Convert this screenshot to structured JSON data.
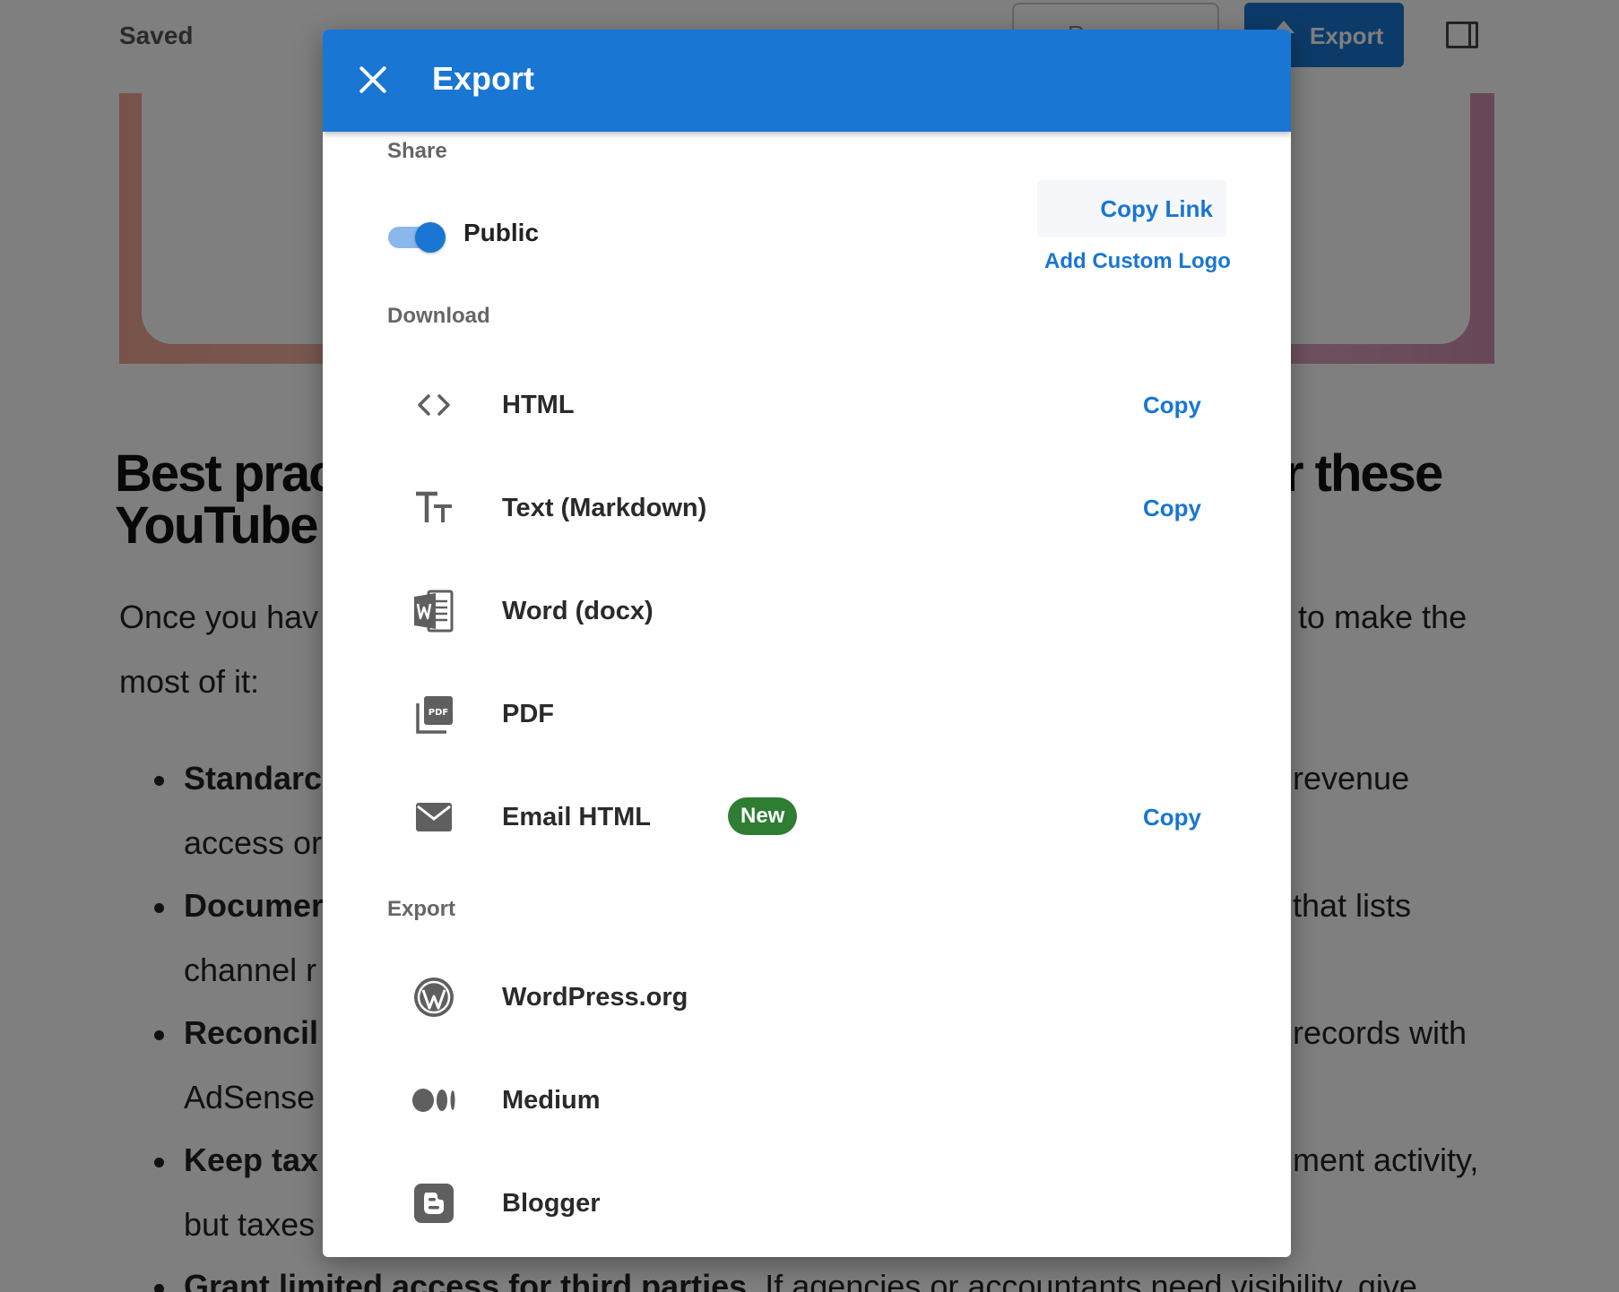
{
  "background": {
    "topbar": {
      "saved": "Saved",
      "revisions": "R",
      "export": "Export"
    },
    "heading_line1": "Best prac",
    "heading_line1_right": "r these",
    "heading_line2": "YouTube U",
    "para1_left": "Once you hav",
    "para1_right": "to make the",
    "para1_line2": "most of it:",
    "bullets": [
      {
        "bold": "Standarc",
        "right": "revenue",
        "line2": "access or"
      },
      {
        "bold": "Documer",
        "right": "that lists",
        "line2": "channel r"
      },
      {
        "bold": "Reconcil",
        "right": "records with",
        "line2": "AdSense"
      },
      {
        "bold": "Keep tax",
        "right": "ment activity,",
        "line2": "but taxes"
      }
    ],
    "last_line_bold": "Grant limited access for third parties.",
    "last_line_rest": " If agencies or accountants need visibility, give"
  },
  "modal": {
    "title": "Export",
    "share": {
      "section_label": "Share",
      "toggle_label": "Public",
      "toggle_on": true,
      "copy_link": "Copy Link",
      "custom_logo": "Add Custom Logo"
    },
    "download": {
      "section_label": "Download",
      "items": [
        {
          "label": "HTML",
          "icon": "code-icon",
          "copy": "Copy"
        },
        {
          "label": "Text (Markdown)",
          "icon": "text-size-icon",
          "copy": "Copy"
        },
        {
          "label": "Word (docx)",
          "icon": "word-doc-icon"
        },
        {
          "label": "PDF",
          "icon": "pdf-icon"
        },
        {
          "label": "Email HTML",
          "icon": "mail-icon",
          "badge": "New",
          "copy": "Copy"
        }
      ]
    },
    "export": {
      "section_label": "Export",
      "items": [
        {
          "label": "WordPress.org",
          "icon": "wordpress-icon"
        },
        {
          "label": "Medium",
          "icon": "medium-icon"
        },
        {
          "label": "Blogger",
          "icon": "blogger-icon"
        }
      ]
    }
  },
  "colors": {
    "primary": "#1976d2",
    "badge_green": "#2e7d32",
    "overlay": "rgba(0,0,0,0.5)"
  }
}
